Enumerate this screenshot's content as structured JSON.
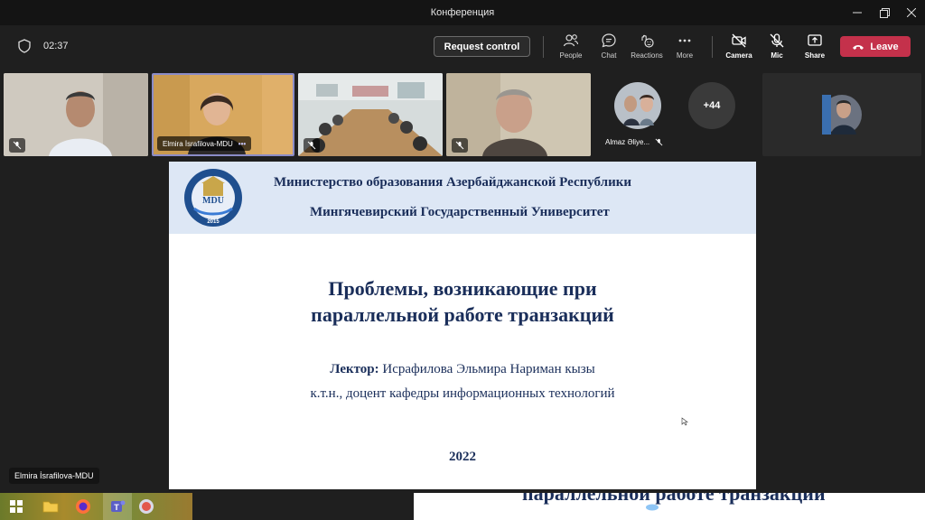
{
  "window": {
    "title": "Конференция"
  },
  "toolbar": {
    "timer": "02:37",
    "request_control": "Request control",
    "people": "People",
    "chat": "Chat",
    "reactions": "Reactions",
    "more": "More",
    "camera": "Camera",
    "mic": "Mic",
    "share": "Share",
    "leave": "Leave"
  },
  "participants": {
    "tile2_name": "Elmira İsrafilova-MDU",
    "tile5_name": "Almaz Əliye...",
    "overflow_count": "+44"
  },
  "slide": {
    "header_line1": "Министерство образования Азербайджанской Республики",
    "header_line2": "Мингячевирский Государственный Университет",
    "logo_text": "MDU",
    "logo_year": "2015",
    "title_line1": "Проблемы, возникающие при",
    "title_line2": "параллельной работе транзакций",
    "lecturer_label": "Лектор:",
    "lecturer_name": " Исрафилова Эльмира Нариман кызы",
    "lecturer_position": "к.т.н., доцент кафедры информационных технологий",
    "year": "2022"
  },
  "presenter_label": "Elmira İsrafilova-MDU",
  "bottom_overflow_text": "параллельной работе транзакций",
  "colors": {
    "leave": "#c4314b",
    "slide_header": "#dde7f5",
    "slide_text": "#1a2e5a",
    "active_border": "#8b8cc7"
  }
}
